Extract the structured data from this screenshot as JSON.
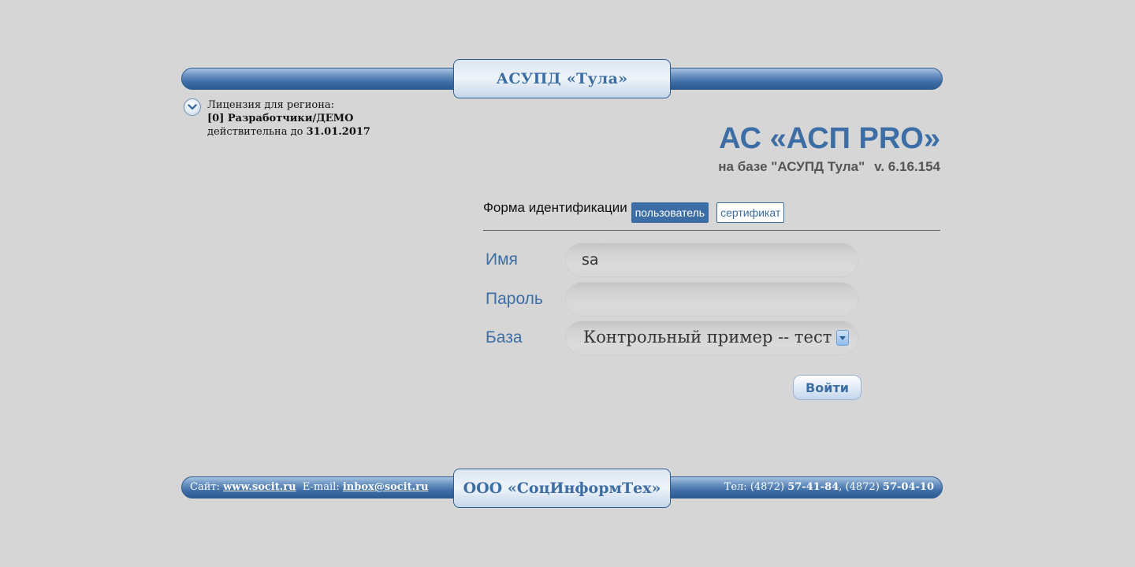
{
  "header": {
    "system_title": "АСУПД «Тула»"
  },
  "license": {
    "label": "Лицензия для региона:",
    "region": "[0] Разработчики/ДЕМО",
    "valid_prefix": "действительна до",
    "valid_until": "31.01.2017",
    "toggle_icon": "chevron-down-icon"
  },
  "product": {
    "title": "АС «АСП PRO»",
    "base": "на базе \"АСУПД Тула\"",
    "version": "v. 6.16.154"
  },
  "form": {
    "ident_label": "Форма идентификации",
    "mode_user": "пользователь",
    "mode_certificate": "сертификат",
    "active_mode": "пользователь",
    "name_label": "Имя",
    "name_value": "sa",
    "password_label": "Пароль",
    "password_value": "",
    "base_label": "База",
    "base_value": "Контрольный пример -- тест",
    "login_button": "Войти"
  },
  "footer": {
    "site_label": "Сайт:",
    "site": "www.socit.ru",
    "email_label": "E-mail:",
    "email": "inbox@socit.ru",
    "company": "ООО «СоцИнформТех»",
    "phone_label": "Тел:",
    "phone1_code": "(4872)",
    "phone1_number": "57-41-84",
    "phone2_code": "(4872)",
    "phone2_number": "57-04-10"
  },
  "colors": {
    "accent": "#3c6ea5",
    "background": "#d6d6d6",
    "bar_dark": "#2b5a91"
  }
}
